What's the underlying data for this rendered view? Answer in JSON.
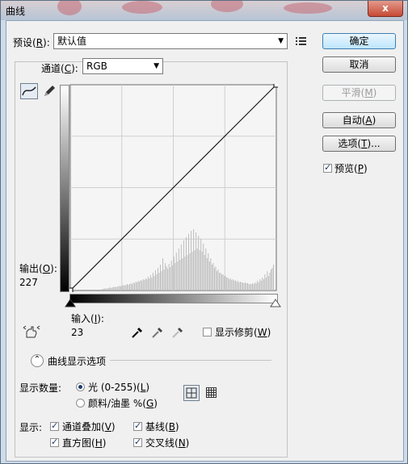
{
  "window": {
    "title": "曲线",
    "close_glyph": "x"
  },
  "preset": {
    "label": "预设(",
    "key": "R",
    "suffix": "):",
    "value": "默认值",
    "menu_icon": "preset-menu-icon"
  },
  "channel": {
    "label": "通道(",
    "key": "C",
    "suffix": "):",
    "value": "RGB"
  },
  "output": {
    "label": "输出(",
    "key": "O",
    "suffix": "):",
    "value": "227"
  },
  "input": {
    "label": "输入(",
    "key": "I",
    "suffix": "):",
    "value": "23"
  },
  "show_clipping": {
    "label": "显示修剪(",
    "key": "W",
    "suffix": ")",
    "checked": false
  },
  "display_options": {
    "label": "曲线显示选项"
  },
  "show_amount": {
    "label": "显示数量:",
    "light": "光 (0-255)(",
    "light_key": "L",
    "light_suffix": ")",
    "pigment": "颜料/油墨 %(",
    "pigment_key": "G",
    "pigment_suffix": ")",
    "selected": "light"
  },
  "show": {
    "label": "显示:",
    "channel_overlays": {
      "text": "通道叠加(",
      "key": "V",
      "suffix": ")",
      "checked": true
    },
    "baseline": {
      "text": "基线(",
      "key": "B",
      "suffix": ")",
      "checked": true
    },
    "histogram": {
      "text": "直方图(",
      "key": "H",
      "suffix": ")",
      "checked": true
    },
    "intersection": {
      "text": "交叉线(",
      "key": "N",
      "suffix": ")",
      "checked": true
    }
  },
  "buttons": {
    "ok": "确定",
    "cancel": "取消",
    "smooth": "平滑(",
    "smooth_key": "M",
    "smooth_suffix": ")",
    "auto": "自动(",
    "auto_key": "A",
    "auto_suffix": ")",
    "options": "选项(",
    "options_key": "T",
    "options_suffix": ")...",
    "preview": "预览(",
    "preview_key": "P",
    "preview_suffix": ")"
  },
  "preview_checked": true,
  "chart_data": {
    "type": "line",
    "x": [
      0,
      255
    ],
    "values": [
      0,
      255
    ],
    "xlim": [
      0,
      255
    ],
    "ylim": [
      0,
      255
    ],
    "grid": "4x4",
    "histogram": [
      2,
      2,
      3,
      2,
      3,
      3,
      4,
      3,
      4,
      4,
      5,
      4,
      5,
      5,
      6,
      5,
      6,
      7,
      6,
      7,
      8,
      7,
      8,
      9,
      8,
      10,
      9,
      11,
      10,
      12,
      11,
      13,
      12,
      14,
      13,
      15,
      14,
      17,
      15,
      19,
      16,
      22,
      18,
      25,
      20,
      28,
      22,
      32,
      24,
      40,
      26,
      34,
      30,
      27,
      33,
      29,
      37,
      31,
      42,
      34,
      47,
      36,
      52,
      38,
      57,
      40,
      62,
      42,
      66,
      44,
      70,
      46,
      74,
      48,
      76,
      50,
      72,
      52,
      68,
      50,
      64,
      48,
      58,
      44,
      52,
      40,
      46,
      36,
      40,
      32,
      34,
      28,
      30,
      24,
      26,
      22,
      22,
      20,
      20,
      18,
      18,
      16,
      16,
      14,
      15,
      13,
      14,
      12,
      13,
      11,
      12,
      10,
      11,
      10,
      10,
      9,
      10,
      9,
      9,
      8,
      8,
      8,
      9,
      8,
      10,
      9,
      12,
      10,
      14,
      12,
      16,
      14,
      20,
      16,
      24,
      18,
      22,
      26,
      28,
      32
    ]
  }
}
